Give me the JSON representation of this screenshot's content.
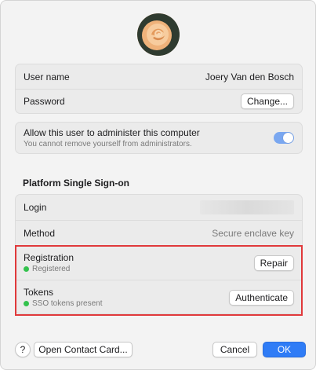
{
  "user": {
    "avatar_icon": "rose-photo-avatar",
    "name_label": "User name",
    "name_value": "Joery Van den Bosch",
    "password_label": "Password",
    "change_button": "Change..."
  },
  "admin": {
    "label": "Allow this user to administer this computer",
    "note": "You cannot remove yourself from administrators.",
    "toggle_on": true
  },
  "sso": {
    "section_title": "Platform Single Sign-on",
    "login_label": "Login",
    "method_label": "Method",
    "method_value": "Secure enclave key",
    "registration_label": "Registration",
    "registration_status": "Registered",
    "repair_button": "Repair",
    "tokens_label": "Tokens",
    "tokens_status": "SSO tokens present",
    "authenticate_button": "Authenticate",
    "status_color": "#33c24d",
    "highlight_color": "#e0393b"
  },
  "footer": {
    "help_button": "?",
    "contact_button": "Open Contact Card...",
    "cancel_button": "Cancel",
    "ok_button": "OK"
  },
  "colors": {
    "accent": "#2f7cf6",
    "toggle": "#7aa7f0"
  }
}
